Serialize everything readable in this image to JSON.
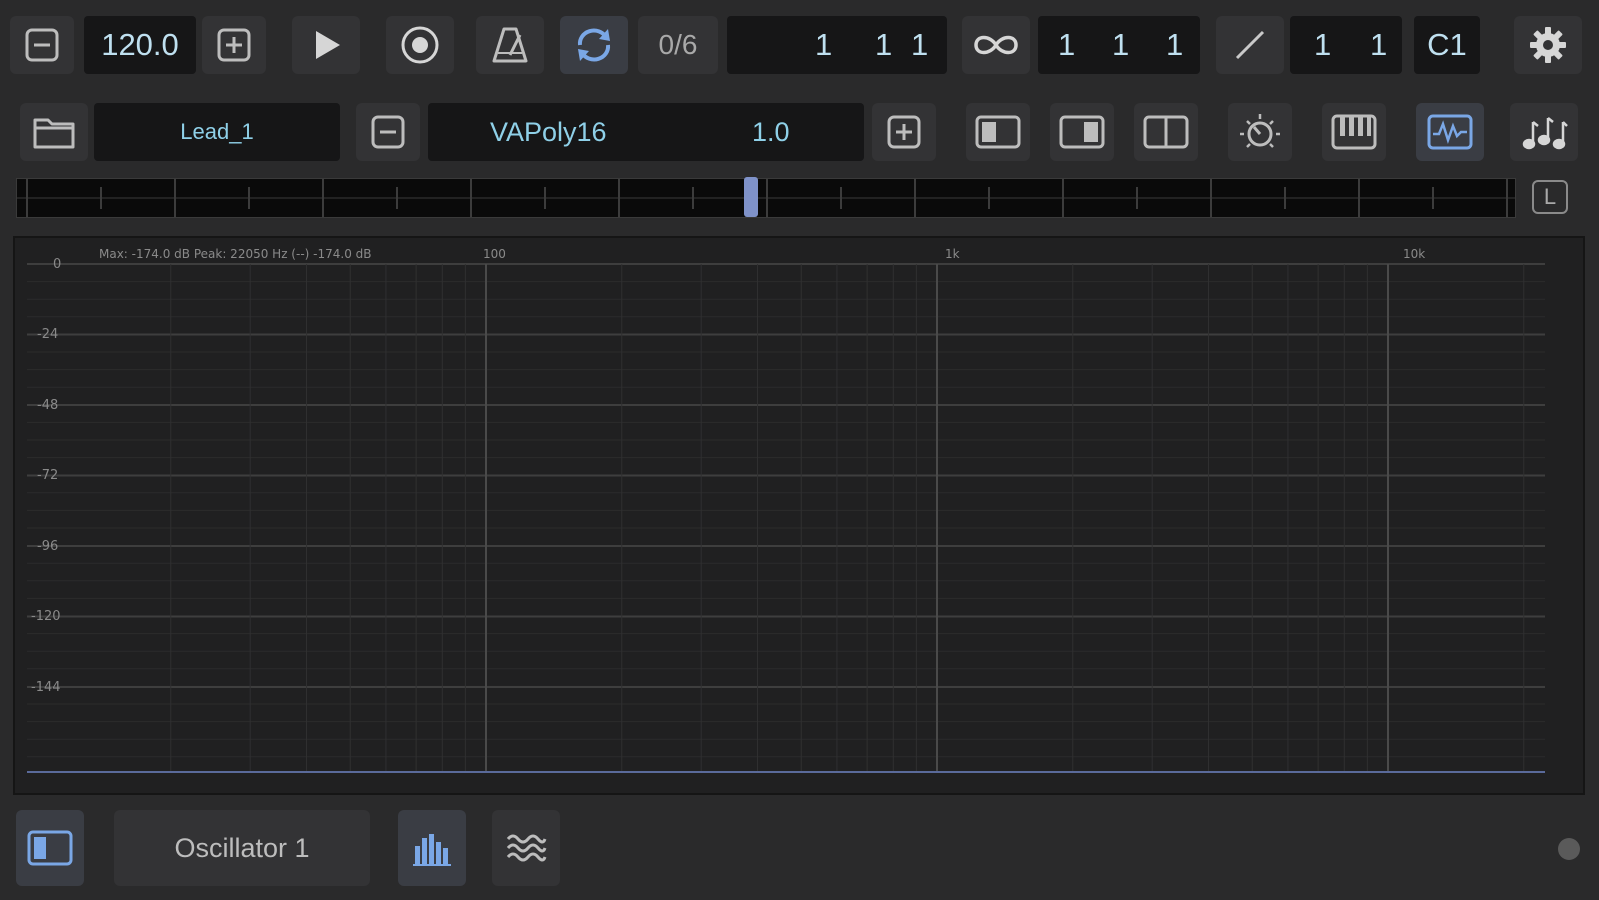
{
  "transport": {
    "tempo": "120.0",
    "pattern_count": "0/6",
    "position": {
      "bar": "1",
      "beat": "1",
      "tick": "1"
    },
    "loop_length": {
      "bar": "1",
      "beat": "1",
      "tick": "1"
    },
    "signature": {
      "num": "1",
      "den": "1"
    },
    "key": "C1"
  },
  "instrument": {
    "preset_name": "Lead_1",
    "synth_name": "VAPoly16",
    "version": "1.0"
  },
  "meter": {
    "lock_label": "L",
    "knob_position": 0.49
  },
  "spectrum": {
    "info_text": "Max: -174.0 dB  Peak: 22050 Hz  (--)  -174.0 dB",
    "y_labels": [
      "0",
      "-24",
      "-48",
      "-72",
      "-96",
      "-120",
      "-144"
    ],
    "x_labels": [
      "100",
      "1k",
      "10k"
    ]
  },
  "bottom": {
    "module_name": "Oscillator 1"
  },
  "colors": {
    "accent": "#7aa7e6",
    "display_text": "#bfe0f0",
    "panel": "#2a2a2b",
    "button": "#333335"
  }
}
